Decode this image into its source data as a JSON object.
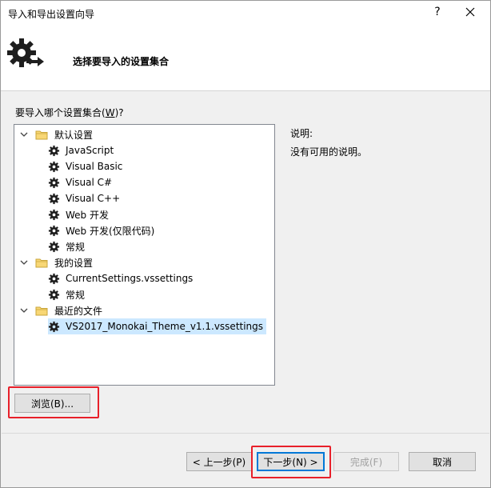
{
  "window": {
    "title": "导入和导出设置向导",
    "help_label": "?"
  },
  "header": {
    "icon": "gear-import-icon",
    "title": "选择要导入的设置集合"
  },
  "question": {
    "prefix": "要导入哪个设置集合(",
    "mnemonic": "W",
    "suffix": ")?"
  },
  "tree": {
    "groups": [
      {
        "label": "默认设置",
        "expanded": true,
        "items": [
          "JavaScript",
          "Visual Basic",
          "Visual C#",
          "Visual C++",
          "Web 开发",
          "Web 开发(仅限代码)",
          "常规"
        ]
      },
      {
        "label": "我的设置",
        "expanded": true,
        "items": [
          "CurrentSettings.vssettings",
          "常规"
        ]
      },
      {
        "label": "最近的文件",
        "expanded": true,
        "items": [
          "VS2017_Monokai_Theme_v1.1.vssettings"
        ]
      }
    ],
    "selected": "VS2017_Monokai_Theme_v1.1.vssettings"
  },
  "description": {
    "label": "说明:",
    "text": "没有可用的说明。"
  },
  "buttons": {
    "browse": "浏览(B)...",
    "prev": "< 上一步(P)",
    "next": "下一步(N) >",
    "finish": "完成(F)",
    "cancel": "取消"
  },
  "colors": {
    "highlight": "#e8202a",
    "selection": "#cce8ff",
    "primary_border": "#0078d7"
  }
}
